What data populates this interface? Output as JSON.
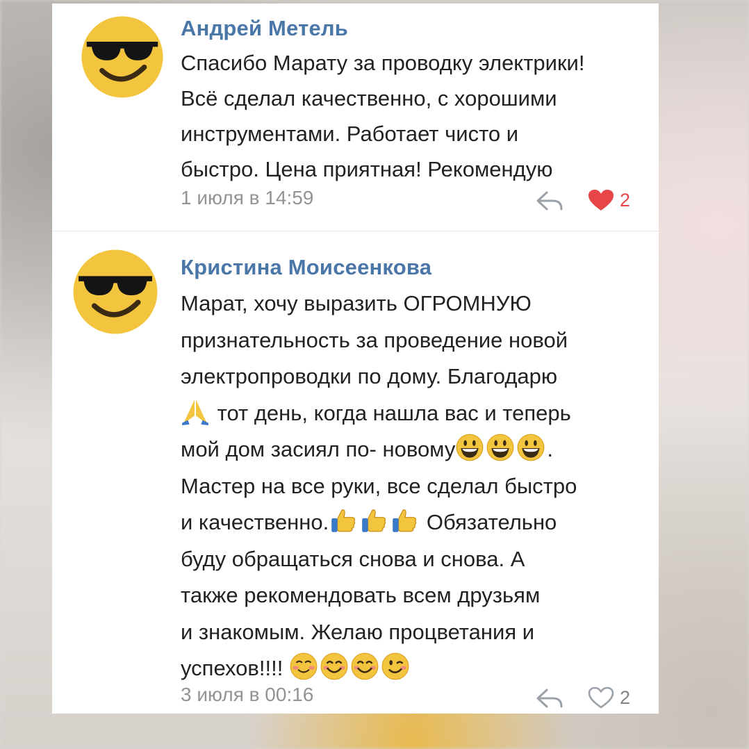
{
  "comments": [
    {
      "author": "Андрей Метель",
      "lines": [
        "Спасибо Марату за проводку электрики!",
        "Всё сделал качественно, с хорошими",
        "инструментами. Работает чисто и",
        "быстро.  Цена приятная! Рекомендую"
      ],
      "date": "1 июля в 14:59",
      "likes": "2",
      "liked": true
    },
    {
      "author": "Кристина Моисеенкова",
      "lines": [
        "Марат, хочу выразить ОГРОМНУЮ",
        "признательность за проведение новой",
        "электропроводки по дому. Благодарю",
        " тот день, когда нашла вас и теперь",
        "мой дом засиял по- новому",
        ".",
        "Мастер на все руки, все сделал быстро",
        "и качественно.",
        " Обязательно",
        "буду обращаться снова и снова. А",
        "также рекомендовать всем друзьям",
        "и знакомым. Желаю процветания и",
        "успехов!!!! "
      ],
      "date": "3 июля в 00:16",
      "likes": "2",
      "liked": false
    }
  ],
  "icons": {
    "avatar": "sunglasses-smiley-icon",
    "reply": "reply-arrow-icon",
    "like_filled": "heart-filled-icon",
    "like_outline": "heart-outline-icon",
    "emoji_pray": "folded-hands-icon",
    "emoji_grin": "grinning-face-icon",
    "emoji_thumbs": "thumbs-up-icon",
    "emoji_blush": "smiling-face-icon",
    "emoji_smile": "smiling-eyes-icon",
    "emoji_wink": "winking-face-icon"
  },
  "colors": {
    "author": "#4a76a8",
    "like_active": "#e64646",
    "meta": "#939393",
    "text": "#222222"
  }
}
